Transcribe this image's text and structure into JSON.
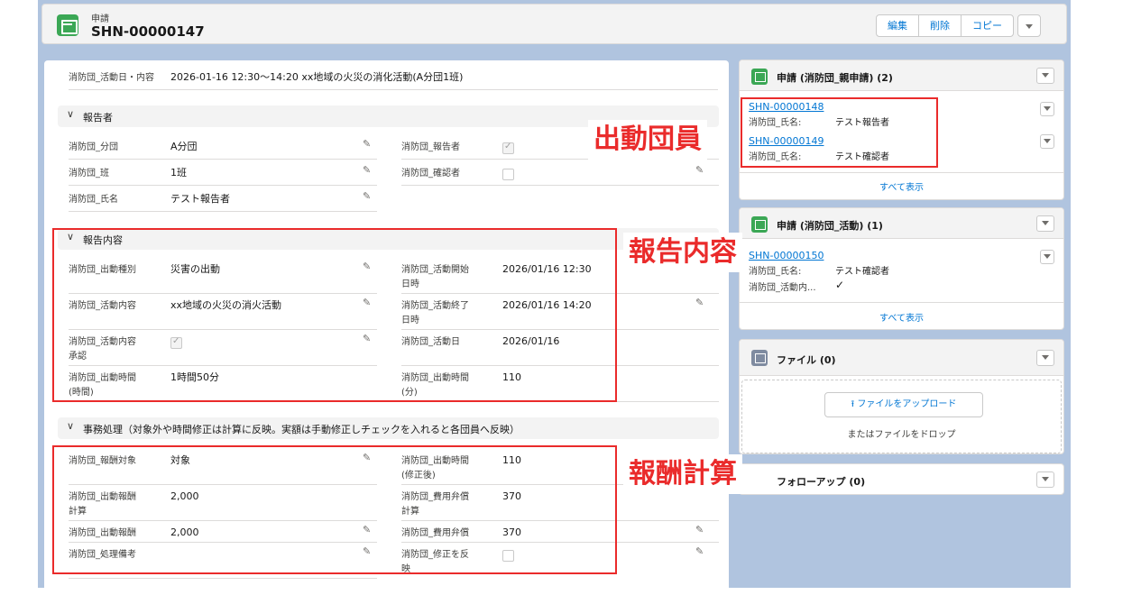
{
  "header": {
    "object_type": "申請",
    "record_name": "SHN-00000147",
    "edit_label": "編集",
    "delete_label": "削除",
    "copy_label": "コピー"
  },
  "top_field": {
    "label": "消防団_活動日・内容",
    "value": "2026-01-16 12:30〜14:20 xx地域の火災の消化活動(A分団1班)"
  },
  "sections": {
    "reporter": "報告者",
    "report": "報告内容",
    "processing": "事務処理（対象外や時間修正は計算に反映。実額は手動修正しチェックを入れると各団員へ反映）"
  },
  "reporter_fields": {
    "division_label": "消防団_分団",
    "division_value": "A分団",
    "team_label": "消防団_班",
    "team_value": "1班",
    "name_label": "消防団_氏名",
    "name_value": "テスト報告者",
    "reporter_label": "消防団_報告者",
    "reporter_checked": true,
    "confirmer_label": "消防団_確認者",
    "confirmer_checked": false
  },
  "report_fields": {
    "type_label": "消防団_出動種別",
    "type_value": "災害の出動",
    "content_label": "消防団_活動内容",
    "content_value": "xx地域の火災の消火活動",
    "approval_label1": "消防団_活動内容",
    "approval_label2": "承認",
    "approval_checked": true,
    "hours_label1": "消防団_出動時間",
    "hours_label2": "(時間)",
    "hours_value": "1時間50分",
    "start_label1": "消防団_活動開始",
    "start_label2": "日時",
    "start_value": "2026/01/16 12:30",
    "end_label1": "消防団_活動終了",
    "end_label2": "日時",
    "end_value": "2026/01/16 14:20",
    "date_label": "消防団_活動日",
    "date_value": "2026/01/16",
    "minutes_label1": "消防団_出動時間",
    "minutes_label2": "(分)",
    "minutes_value": "110"
  },
  "processing_fields": {
    "target_label": "消防団_報酬対象",
    "target_value": "対象",
    "calc_label1": "消防団_出動報酬",
    "calc_label2": "計算",
    "calc_value": "2,000",
    "reward_label": "消防団_出動報酬",
    "reward_value": "2,000",
    "note_label": "消防団_処理備考",
    "fixed_label1": "消防団_出動時間",
    "fixed_label2": "(修正後)",
    "fixed_value": "110",
    "expcalc_label1": "消防団_費用弁償",
    "expcalc_label2": "計算",
    "expcalc_value": "370",
    "expense_label": "消防団_費用弁償",
    "expense_value": "370",
    "reflect_label1": "消防団_修正を反",
    "reflect_label2": "映",
    "reflect_checked": false
  },
  "annotations": {
    "members": "出動団員",
    "report": "報告内容",
    "reward": "報酬計算"
  },
  "related_parent": {
    "title": "申請 (消防団_親申請) (2)",
    "items": [
      {
        "id": "SHN-00000148",
        "label": "消防団_氏名:",
        "value": "テスト報告者"
      },
      {
        "id": "SHN-00000149",
        "label": "消防団_氏名:",
        "value": "テスト確認者"
      }
    ],
    "view_all": "すべて表示"
  },
  "related_activity": {
    "title": "申請 (消防団_活動) (1)",
    "item": {
      "id": "SHN-00000150",
      "label": "消防団_氏名:",
      "value": "テスト確認者",
      "label2": "消防団_活動内...",
      "check": "✓"
    },
    "view_all": "すべて表示"
  },
  "files": {
    "title": "ファイル (0)",
    "upload_label": "ファイルをアップロード",
    "drop_label": "またはファイルをドロップ"
  },
  "followup": {
    "title": "フォローアップ (0)"
  },
  "colors": {
    "brand_green": "#3ba755",
    "link_blue": "#0176d3",
    "annotation_red": "#ea2b2b",
    "background_blue": "#b0c4df"
  }
}
